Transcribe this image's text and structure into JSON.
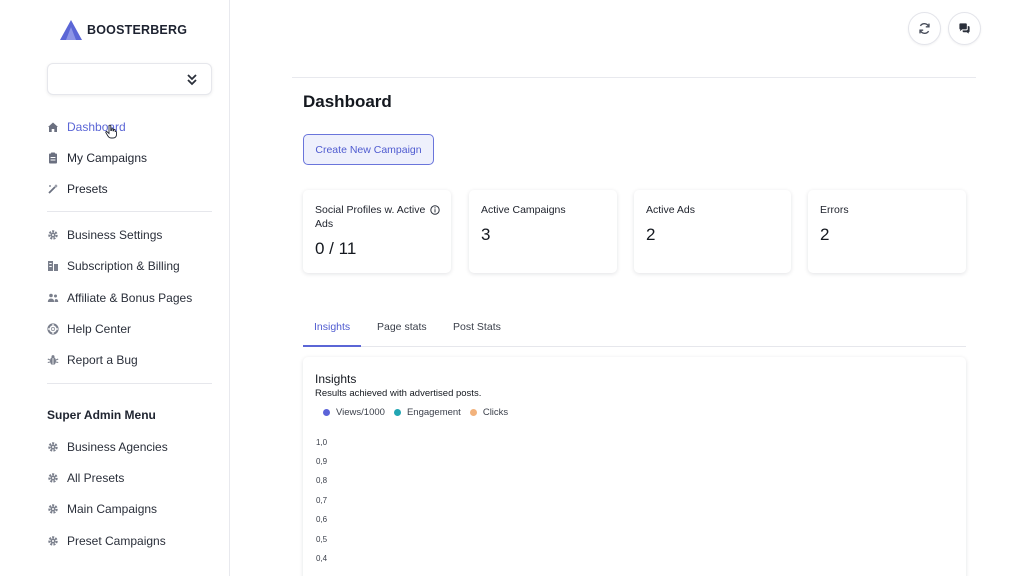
{
  "brand": {
    "name": "BOOSTERBERG",
    "color": "#5b66d6"
  },
  "sidebar": {
    "main_items": [
      {
        "label": "Dashboard",
        "icon": "home-icon",
        "active": true
      },
      {
        "label": "My Campaigns",
        "icon": "clipboard-icon"
      },
      {
        "label": "Presets",
        "icon": "wand-icon"
      }
    ],
    "settings_items": [
      {
        "label": "Business Settings",
        "icon": "gear-icon"
      },
      {
        "label": "Subscription & Billing",
        "icon": "billing-icon"
      },
      {
        "label": "Affiliate & Bonus Pages",
        "icon": "users-icon"
      },
      {
        "label": "Help Center",
        "icon": "lifebuoy-icon"
      },
      {
        "label": "Report a Bug",
        "icon": "bug-icon"
      }
    ],
    "admin_title": "Super Admin Menu",
    "admin_items": [
      {
        "label": "Business Agencies",
        "icon": "gear-icon"
      },
      {
        "label": "All Presets",
        "icon": "gear-icon"
      },
      {
        "label": "Main Campaigns",
        "icon": "gear-icon"
      },
      {
        "label": "Preset Campaigns",
        "icon": "gear-icon"
      }
    ]
  },
  "header": {
    "title": "Dashboard",
    "create_button": "Create New Campaign",
    "icons": [
      "refresh-icon",
      "chat-icon"
    ]
  },
  "stats": [
    {
      "label": "Social Profiles w. Active Ads",
      "value": "0 / 11"
    },
    {
      "label": "Active Campaigns",
      "value": "3"
    },
    {
      "label": "Active Ads",
      "value": "2"
    },
    {
      "label": "Errors",
      "value": "2"
    }
  ],
  "tabs": [
    {
      "label": "Insights",
      "active": true
    },
    {
      "label": "Page stats"
    },
    {
      "label": "Post Stats"
    }
  ],
  "insights": {
    "title": "Insights",
    "subtitle": "Results achieved with advertised posts.",
    "legend": [
      {
        "label": "Views/1000",
        "color": "#5b63d8"
      },
      {
        "label": "Engagement",
        "color": "#22a6b3"
      },
      {
        "label": "Clicks",
        "color": "#f2b27c"
      }
    ],
    "y_ticks": [
      "1,0",
      "0,9",
      "0,8",
      "0,7",
      "0,6",
      "0,5",
      "0,4"
    ]
  }
}
